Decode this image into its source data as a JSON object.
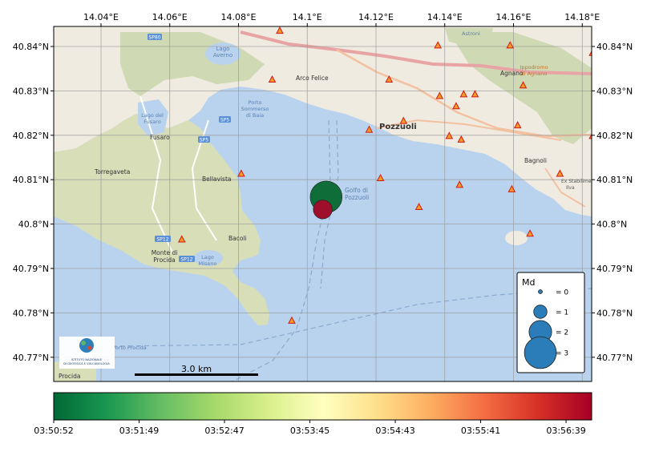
{
  "map": {
    "lon_ticks": [
      "14.04°E",
      "14.06°E",
      "14.08°E",
      "14.1°E",
      "14.12°E",
      "14.14°E",
      "14.16°E",
      "14.18°E"
    ],
    "lat_ticks": [
      "40.84°N",
      "40.83°N",
      "40.82°N",
      "40.81°N",
      "40.8°N",
      "40.79°N",
      "40.78°N",
      "40.77°N"
    ],
    "place_labels": {
      "lago_averno": "Lago\nAverno",
      "arco_felice": "Arco Felice",
      "porto": "Porto\nSommerso\ndi Baia",
      "lago_fusaro": "Lago del\nFusaro",
      "fusaro": "Fusaro",
      "torregaveta": "Torregaveta",
      "bellavista": "Bellavista",
      "golfo": "Golfo di\nPozzuoli",
      "pozzuoli": "Pozzuoli",
      "agnano": "Agnano",
      "ippodromo": "Ippodromo\ndi Agnano",
      "bagnoli": "Bagnoli",
      "stabilimento": "Ex Stabilimento\nIlva",
      "bacoli": "Bacoli",
      "monte_di_procida": "Monte di\nProcida",
      "lago_miseno": "Lago\nMiseno",
      "procida": "Procida",
      "astroni": "Astroni",
      "porto_procida": "Porto Procida"
    },
    "road_shields": [
      "SP80",
      "SP5",
      "SP5",
      "SP12",
      "SP12"
    ],
    "scalebar_label": "3.0 km",
    "logo_text": "ISTITUTO NAZIONALE\nDI GEOFISICA E VULCANOLOGIA"
  },
  "events": [
    {
      "lon": 14.1055,
      "lat": 40.8061,
      "md": 3.0,
      "time": "03:50:52",
      "color": "#0e6d38"
    },
    {
      "lon": 14.1045,
      "lat": 40.8033,
      "md": 1.6,
      "time": "03:56:55",
      "color": "#9d0f2b"
    }
  ],
  "stations": [
    {
      "lon": 14.092,
      "lat": 40.8435
    },
    {
      "lon": 14.138,
      "lat": 40.8402
    },
    {
      "lon": 14.159,
      "lat": 40.8402
    },
    {
      "lon": 14.183,
      "lat": 40.8385
    },
    {
      "lon": 14.0898,
      "lat": 40.8325
    },
    {
      "lon": 14.1238,
      "lat": 40.8325
    },
    {
      "lon": 14.1385,
      "lat": 40.8288
    },
    {
      "lon": 14.1455,
      "lat": 40.8292
    },
    {
      "lon": 14.1488,
      "lat": 40.8292
    },
    {
      "lon": 14.1433,
      "lat": 40.8265
    },
    {
      "lon": 14.1628,
      "lat": 40.8312
    },
    {
      "lon": 14.128,
      "lat": 40.8232
    },
    {
      "lon": 14.118,
      "lat": 40.8212
    },
    {
      "lon": 14.1413,
      "lat": 40.8198
    },
    {
      "lon": 14.1448,
      "lat": 40.819
    },
    {
      "lon": 14.1612,
      "lat": 40.8222
    },
    {
      "lon": 14.183,
      "lat": 40.8198
    },
    {
      "lon": 14.0808,
      "lat": 40.8113
    },
    {
      "lon": 14.1213,
      "lat": 40.8103
    },
    {
      "lon": 14.1443,
      "lat": 40.8088
    },
    {
      "lon": 14.1595,
      "lat": 40.8078
    },
    {
      "lon": 14.1735,
      "lat": 40.8113
    },
    {
      "lon": 14.1325,
      "lat": 40.8038
    },
    {
      "lon": 14.1648,
      "lat": 40.7978
    },
    {
      "lon": 14.0635,
      "lat": 40.7965
    },
    {
      "lon": 14.0955,
      "lat": 40.7782
    }
  ],
  "legend": {
    "title": "Md",
    "items": [
      {
        "label": "= 0",
        "md": 0
      },
      {
        "label": "= 1",
        "md": 1
      },
      {
        "label": "= 2",
        "md": 2
      },
      {
        "label": "= 3",
        "md": 3
      }
    ]
  },
  "colorbar": {
    "ticks": [
      "03:50:52",
      "03:51:49",
      "03:52:47",
      "03:53:45",
      "03:54:43",
      "03:55:41",
      "03:56:39"
    ],
    "colors": [
      "#006837",
      "#1a9850",
      "#66bd63",
      "#a6d96a",
      "#d9ef8b",
      "#ffffbf",
      "#fee08b",
      "#fdae61",
      "#f46d43",
      "#d73027",
      "#a50026"
    ]
  },
  "colors": {
    "sea": "#b9d3ef",
    "land": "#f0ebe0",
    "hills": "#cfd9b3",
    "station_fill": "#f59a23",
    "station_edge": "#d11a1a",
    "legend_marker": "#2a7db8"
  }
}
